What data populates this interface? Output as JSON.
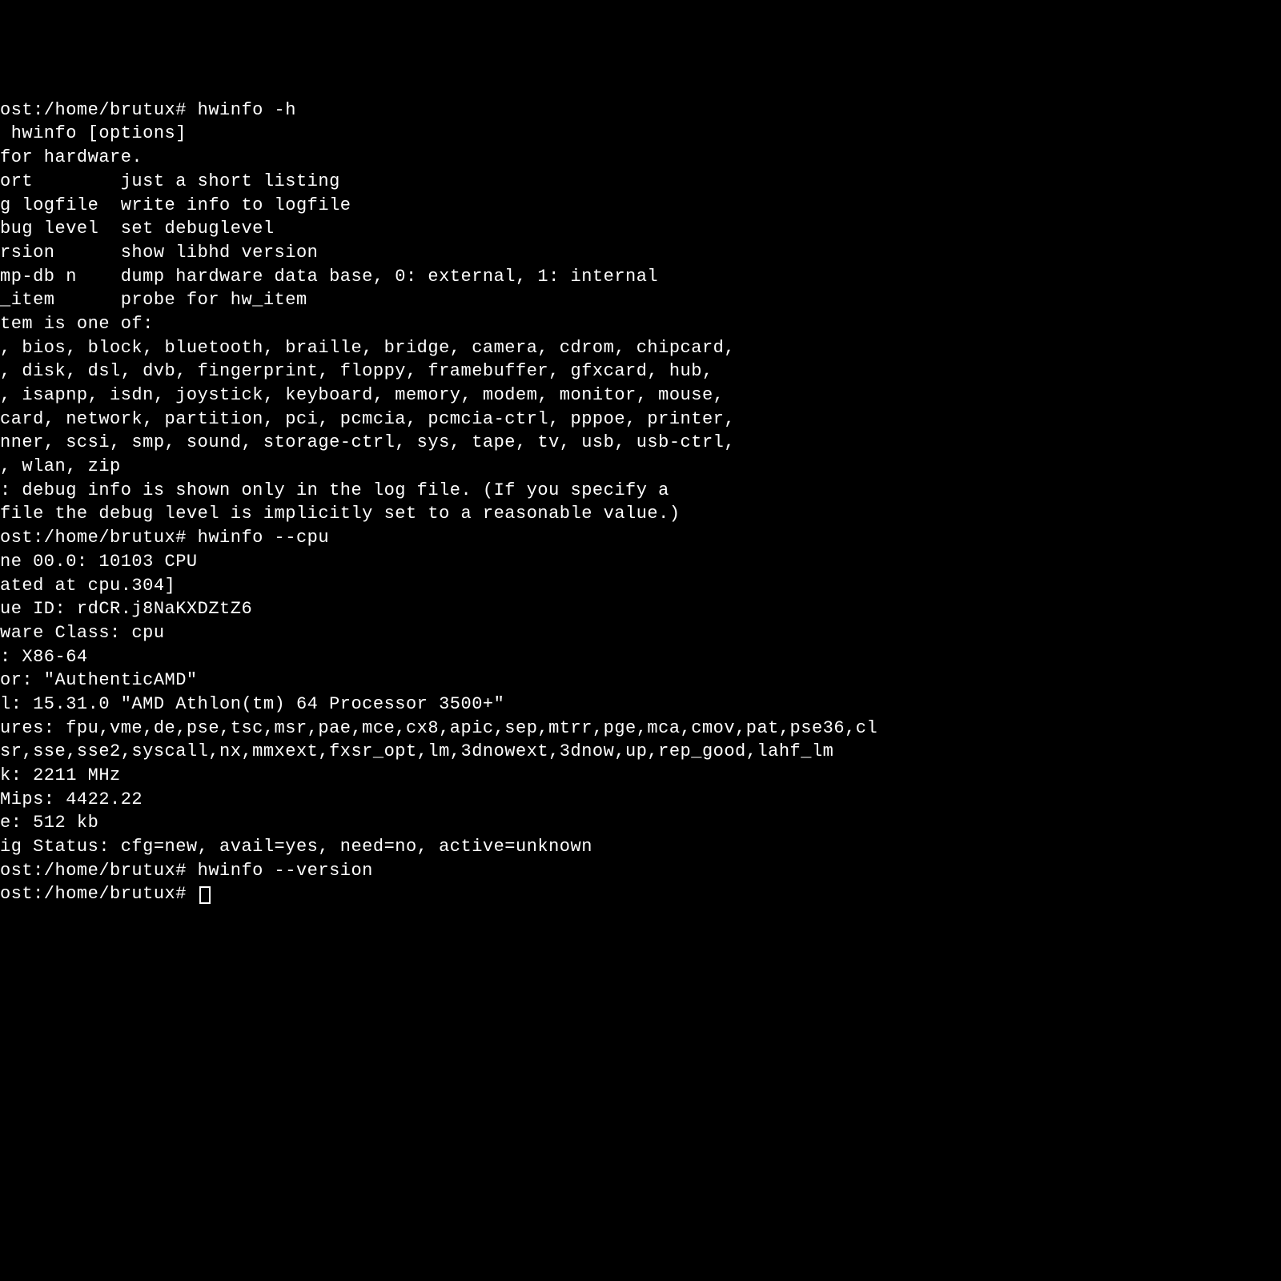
{
  "terminal": {
    "lines": [
      "ost:/home/brutux# hwinfo -h",
      " hwinfo [options]",
      "for hardware.",
      "ort        just a short listing",
      "g logfile  write info to logfile",
      "bug level  set debuglevel",
      "rsion      show libhd version",
      "mp-db n    dump hardware data base, 0: external, 1: internal",
      "_item      probe for hw_item",
      "tem is one of:",
      ", bios, block, bluetooth, braille, bridge, camera, cdrom, chipcard,",
      ", disk, dsl, dvb, fingerprint, floppy, framebuffer, gfxcard, hub,",
      ", isapnp, isdn, joystick, keyboard, memory, modem, monitor, mouse,",
      "card, network, partition, pci, pcmcia, pcmcia-ctrl, pppoe, printer,",
      "nner, scsi, smp, sound, storage-ctrl, sys, tape, tv, usb, usb-ctrl,",
      ", wlan, zip",
      "",
      ": debug info is shown only in the log file. (If you specify a",
      "file the debug level is implicitly set to a reasonable value.)",
      "ost:/home/brutux# hwinfo --cpu",
      "ne 00.0: 10103 CPU",
      "ated at cpu.304]",
      "ue ID: rdCR.j8NaKXDZtZ6",
      "ware Class: cpu",
      ": X86-64",
      "or: \"AuthenticAMD\"",
      "l: 15.31.0 \"AMD Athlon(tm) 64 Processor 3500+\"",
      "ures: fpu,vme,de,pse,tsc,msr,pae,mce,cx8,apic,sep,mtrr,pge,mca,cmov,pat,pse36,cl",
      "sr,sse,sse2,syscall,nx,mmxext,fxsr_opt,lm,3dnowext,3dnow,up,rep_good,lahf_lm",
      "k: 2211 MHz",
      "Mips: 4422.22",
      "e: 512 kb",
      "ig Status: cfg=new, avail=yes, need=no, active=unknown",
      "ost:/home/brutux# hwinfo --version",
      "",
      "ost:/home/brutux# "
    ]
  }
}
